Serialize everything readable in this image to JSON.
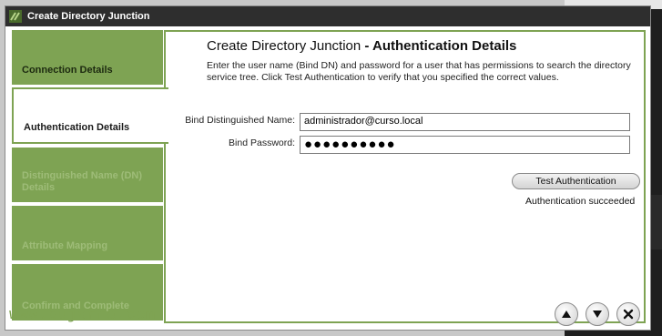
{
  "window": {
    "title": "Create Directory Junction"
  },
  "nav": {
    "steps": [
      {
        "label": "Connection Details",
        "state": "done"
      },
      {
        "label": "Authentication Details",
        "state": "active"
      },
      {
        "label": "Distinguished Name (DN) Details",
        "state": "pending"
      },
      {
        "label": "Attribute Mapping",
        "state": "pending"
      },
      {
        "label": "Confirm and Complete",
        "state": "pending"
      }
    ]
  },
  "main": {
    "heading_prefix": "Create Directory Junction",
    "heading_separator": " - ",
    "heading_section": "Authentication Details",
    "intro": "Enter the user name (Bind DN) and password for a user that has permissions to search the directory service tree.  Click Test Authentication to verify that you specified the correct values.",
    "bind_dn_label": "Bind Distinguished Name:",
    "bind_dn_value": "administrador@curso.local",
    "bind_password_label": "Bind Password:",
    "bind_password_value": "●●●●●●●●●●",
    "test_button": "Test Authentication",
    "status": "Authentication succeeded"
  },
  "footer": {
    "up_icon": "triangle-up-icon",
    "down_icon": "triangle-down-icon",
    "close_icon": "close-icon"
  },
  "watermark": "www.bujarra.com",
  "colors": {
    "accent_green": "#7ea353",
    "titlebar": "#2e2e2e"
  }
}
